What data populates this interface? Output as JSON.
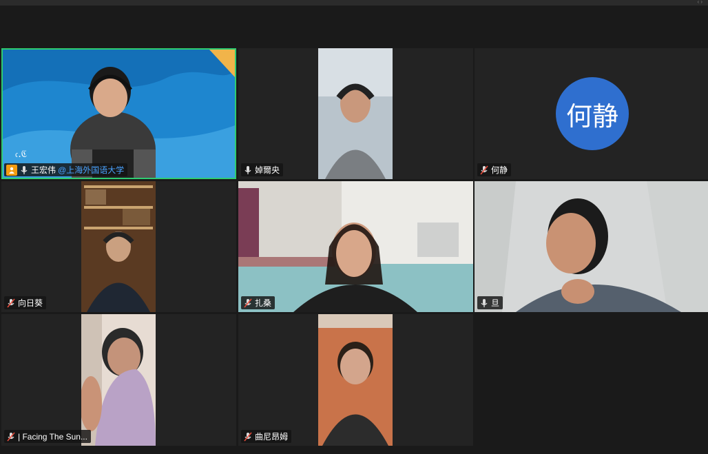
{
  "participants": [
    {
      "name": "王宏伟",
      "org": "@上海外国语大学",
      "muted": false,
      "host": true
    },
    {
      "name": "婥爾央",
      "muted": false
    },
    {
      "name": "何静",
      "muted": true,
      "avatar_text": "何静",
      "avatar_color": "#2f6fcf"
    },
    {
      "name": "向日葵",
      "muted": true
    },
    {
      "name": "扎桑",
      "muted": true
    },
    {
      "name": "旦",
      "muted": false
    },
    {
      "name": "| Facing The Sun...",
      "muted": true
    },
    {
      "name": "曲尼昂姆",
      "muted": true
    }
  ],
  "colors": {
    "active_border": "#2ecc71",
    "accent": "#4aa3ff",
    "host_badge": "#f39c12"
  },
  "icons": {
    "mic": "mic-icon",
    "mic_muted": "mic-muted-icon",
    "user": "user-icon"
  }
}
